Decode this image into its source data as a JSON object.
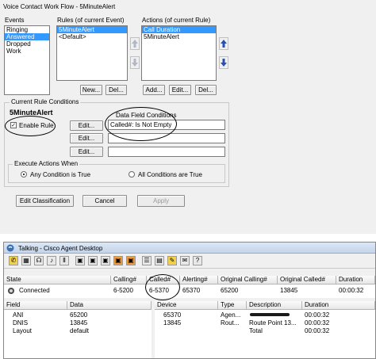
{
  "window_title": "Voice Contact Work Flow - 5MinuteAlert",
  "events": {
    "label": "Events",
    "items": [
      "Ringing",
      "Answered",
      "Dropped",
      "Work"
    ],
    "selected": 1
  },
  "rules": {
    "label": "Rules (of current Event)",
    "items": [
      "5MinuteAlert",
      "<Default>"
    ],
    "selected": 0,
    "new_label": "New...",
    "del_label": "Del..."
  },
  "actions": {
    "label": "Actions (of current Rule)",
    "items": [
      "Call Duration",
      "5MinuteAlert"
    ],
    "selected": 0,
    "add_label": "Add...",
    "edit_label": "Edit...",
    "del_label": "Del..."
  },
  "conditions": {
    "group_label": "Current Rule Conditions",
    "rule_name": "5MinuteAlert",
    "enable_label": "Enable Rule",
    "enabled": true,
    "edit_label": "Edit...",
    "data_field_label": "Data Field Conditions",
    "rows": [
      "Called#:  Is Not Empty",
      "",
      ""
    ]
  },
  "execute": {
    "group_label": "Execute Actions When",
    "option_any": "Any Condition is True",
    "option_all": "All Conditions are True",
    "selected": "any"
  },
  "buttons": {
    "edit_classification": "Edit Classification",
    "cancel": "Cancel",
    "apply": "Apply"
  },
  "agent": {
    "title": "Talking - Cisco Agent Desktop",
    "call_columns": [
      "State",
      "Calling#",
      "Called#",
      "Alerting#",
      "Original Calling#",
      "Original Called#",
      "Duration"
    ],
    "call_row": [
      "Connected",
      "6-5200",
      "6-5370",
      "65370",
      "65200",
      "13845",
      "00:00:32"
    ],
    "field_columns": [
      "Field",
      "Data"
    ],
    "field_rows": [
      [
        "ANI",
        "65200"
      ],
      [
        "DNIS",
        "13845"
      ],
      [
        "Layout",
        "default"
      ]
    ],
    "device_columns": [
      "Device",
      "Type",
      "Description",
      "Duration"
    ],
    "device_rows": [
      [
        "65370",
        "Agen...",
        "",
        "00:00:32"
      ],
      [
        "13845",
        "Rout...",
        "Route Point 13...",
        "00:00:32"
      ],
      [
        "",
        "",
        "Total",
        "00:00:32"
      ]
    ]
  }
}
